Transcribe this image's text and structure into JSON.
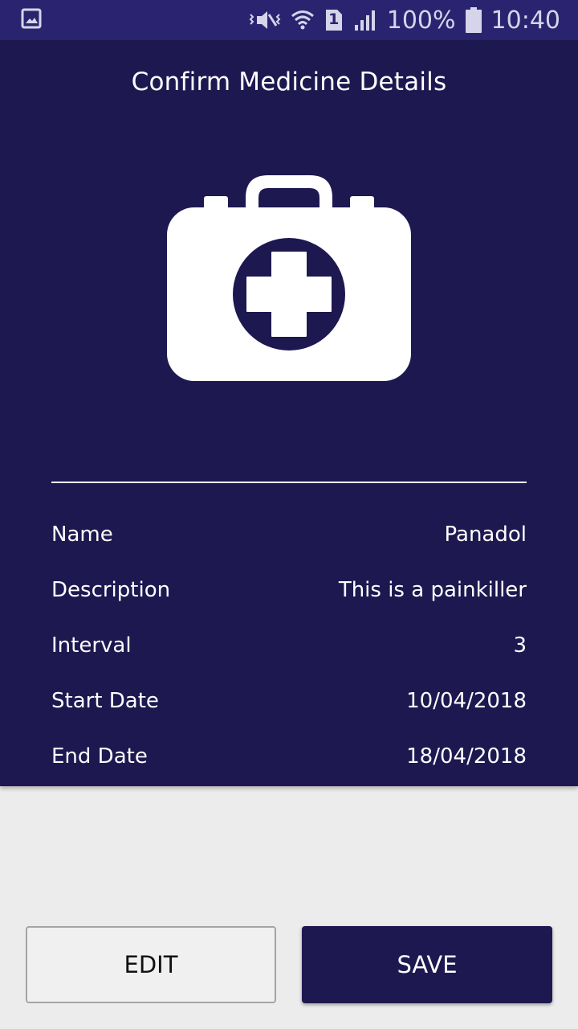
{
  "status_bar": {
    "battery_percent": "100%",
    "time": "10:40",
    "sim_slot": "1",
    "icons": [
      "gallery-icon",
      "mute-icon",
      "wifi-icon",
      "sim-icon",
      "signal-icon",
      "battery-icon"
    ]
  },
  "screen": {
    "title": "Confirm Medicine Details",
    "hero_icon": "first-aid-kit-icon"
  },
  "details": [
    {
      "label": "Name",
      "value": "Panadol"
    },
    {
      "label": "Description",
      "value": "This is a painkiller"
    },
    {
      "label": "Interval",
      "value": "3"
    },
    {
      "label": "Start Date",
      "value": "10/04/2018"
    },
    {
      "label": "End Date",
      "value": "18/04/2018"
    }
  ],
  "actions": {
    "edit_label": "EDIT",
    "save_label": "SAVE"
  },
  "colors": {
    "primary": "#1e1850",
    "status_bar": "#2a2470",
    "background": "#ececec",
    "text_on_primary": "#ffffff"
  }
}
